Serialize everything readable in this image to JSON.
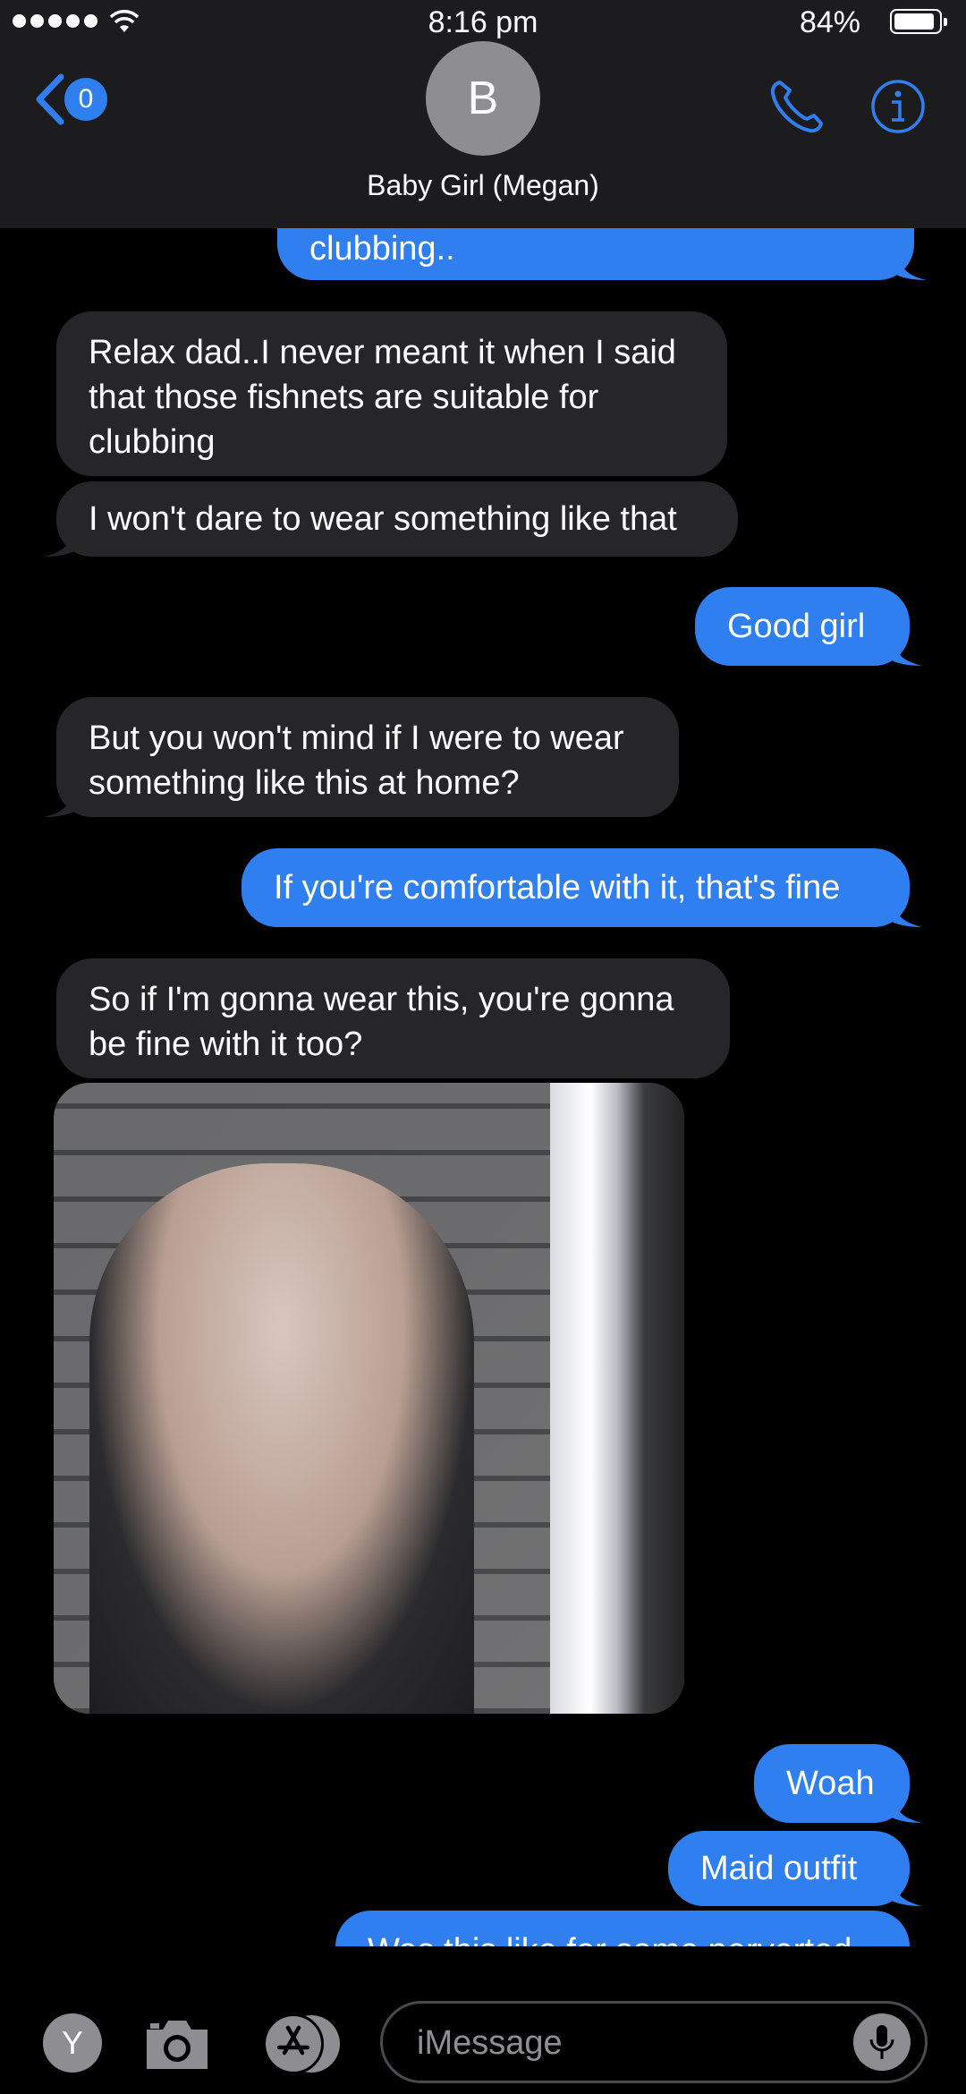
{
  "status_bar": {
    "time": "8:16 pm",
    "battery_percent": "84%"
  },
  "header": {
    "back_count": "0",
    "avatar_initial": "B",
    "contact_name": "Baby Girl (Megan)"
  },
  "messages": [
    {
      "from": "me",
      "text": "clubbing.."
    },
    {
      "from": "them",
      "text": "Relax dad..I never meant it when I said that those fishnets are suitable for clubbing"
    },
    {
      "from": "them",
      "text": "I won't dare to wear something like that"
    },
    {
      "from": "me",
      "text": "Good girl"
    },
    {
      "from": "them",
      "text": "But you won't mind if I were to wear something like this at home?"
    },
    {
      "from": "me",
      "text": "If you're comfortable with it, that's fine"
    },
    {
      "from": "them",
      "text": "So if I'm gonna wear this, you're gonna be fine with it too?"
    },
    {
      "from": "me",
      "text": "Woah"
    },
    {
      "from": "me",
      "text": "Maid outfit"
    },
    {
      "from": "me",
      "text": "Was this like for some perverted"
    }
  ],
  "input_bar": {
    "app_initial": "Y",
    "placeholder": "iMessage"
  },
  "colors": {
    "outgoing_bubble": "#2f7ff0",
    "incoming_bubble": "#262629",
    "header_bg": "#1c1c1e"
  }
}
